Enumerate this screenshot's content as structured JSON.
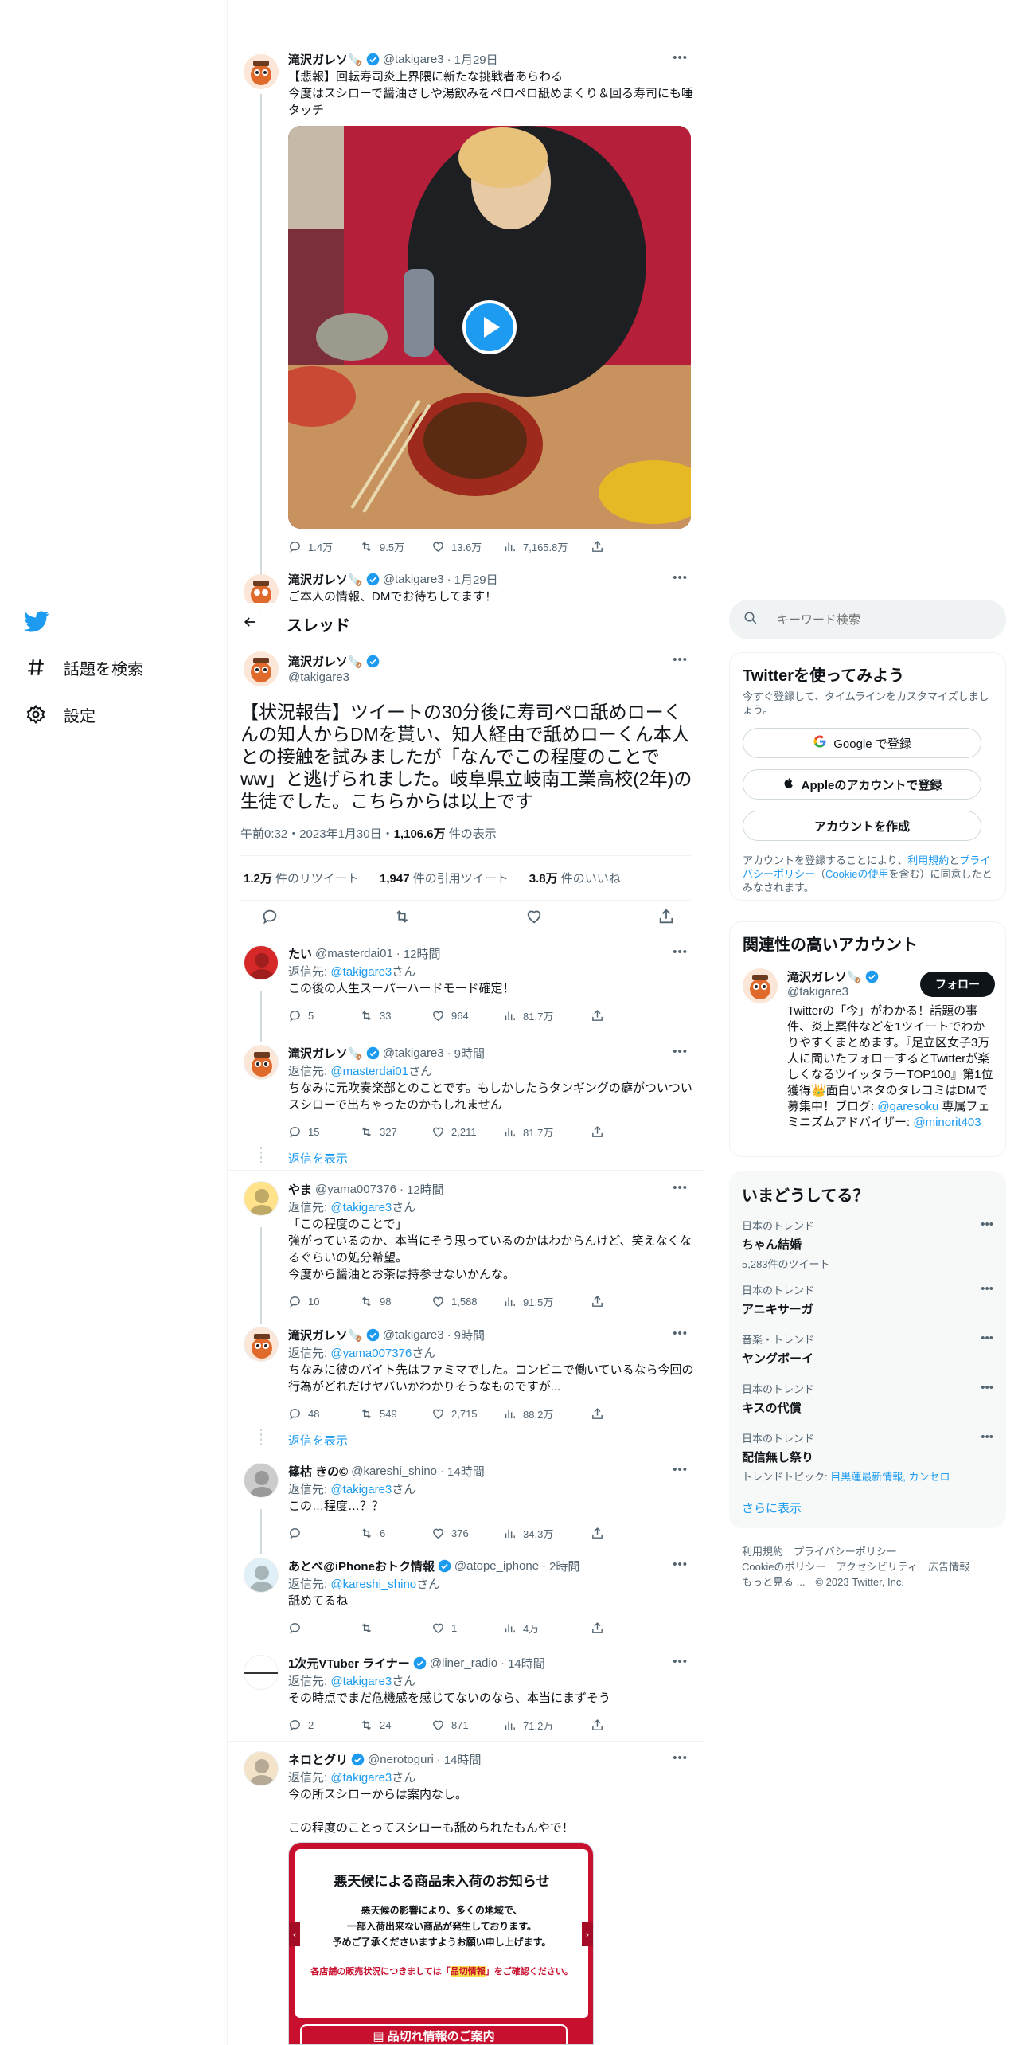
{
  "nav": {
    "explore_label": "話題を検索",
    "settings_label": "設定"
  },
  "header": {
    "title": "スレッド"
  },
  "search": {
    "placeholder": "キーワード検索"
  },
  "prev_tweet": {
    "name": "滝沢ガレソ🪚",
    "handle": "@takigare3",
    "date": "1月29日",
    "text": "【悲報】回転寿司炎上界隈に新たな挑戦者あらわる\n今度はスシローで醤油さしや湯飲みをペロペロ舐めまくり＆回る寿司にも唾タッチ",
    "replies": "1.4万",
    "retweets": "9.5万",
    "likes": "13.6万",
    "views": "7,165.8万"
  },
  "prev_tweet2": {
    "name": "滝沢ガレソ🪚",
    "handle": "@takigare3",
    "date": "1月29日",
    "text": "ご本人の情報、DMでお待ちしてます！"
  },
  "main_tweet": {
    "name": "滝沢ガレソ🪚",
    "handle": "@takigare3",
    "text": "【状況報告】ツイートの30分後に寿司ペロ舐めローくんの知人からDMを貰い、知人経由で舐めローくん本人との接触を試みましたが「なんでこの程度のことでww」と逃げられました。岐阜県立岐南工業高校(2年)の生徒でした。こちらからは以上です",
    "meta_time": "午前0:32・2023年1月30日・",
    "meta_views": "1,106.6万",
    "meta_views_suffix": " 件の表示",
    "rt_count": "1.2万",
    "rt_label": " 件のリツイート",
    "qt_count": "1,947",
    "qt_label": " 件の引用ツイート",
    "like_count": "3.8万",
    "like_label": " 件のいいね"
  },
  "replies": [
    {
      "name": "たい",
      "handle": "@masterdai01",
      "time": "12時間",
      "reply_to": "@takigare3",
      "text": "この後の人生スーパーハードモード確定！",
      "replies": "5",
      "retweets": "33",
      "likes": "964",
      "views": "81.7万"
    },
    {
      "name": "滝沢ガレソ🪚",
      "handle": "@takigare3",
      "time": "9時間",
      "reply_to": "@masterdai01",
      "text": "ちなみに元吹奏楽部とのことです。もしかしたらタンギングの癖がついついスシローで出ちゃったのかもしれません",
      "replies": "15",
      "retweets": "327",
      "likes": "2,211",
      "views": "81.7万"
    },
    {
      "name": "やま",
      "handle": "@yama007376",
      "time": "12時間",
      "reply_to": "@takigare3",
      "text": "「この程度のことで」\n強がっているのか、本当にそう思っているのかはわからんけど、笑えなくなるぐらいの処分希望。\n今度から醤油とお茶は持参せないかんな。",
      "replies": "10",
      "retweets": "98",
      "likes": "1,588",
      "views": "91.5万"
    },
    {
      "name": "滝沢ガレソ🪚",
      "handle": "@takigare3",
      "time": "9時間",
      "reply_to": "@yama007376",
      "text": "ちなみに彼のバイト先はファミマでした。コンビニで働いているなら今回の行為がどれだけヤバいかわかりそうなものですが...",
      "replies": "48",
      "retweets": "549",
      "likes": "2,715",
      "views": "88.2万"
    },
    {
      "name": "篠枯 きの©",
      "handle": "@kareshi_shino",
      "time": "14時間",
      "reply_to": "@takigare3",
      "text": "この…程度…？？",
      "replies": "",
      "retweets": "6",
      "likes": "376",
      "views": "34.3万"
    },
    {
      "name": "あとべ@iPhoneおトク情報",
      "handle": "@atope_iphone",
      "time": "2時間",
      "reply_to": "@kareshi_shino",
      "text": "舐めてるね",
      "replies": "",
      "retweets": "",
      "likes": "1",
      "views": "4万"
    },
    {
      "name": "1次元VTuber ライナー",
      "handle": "@liner_radio",
      "time": "14時間",
      "reply_to": "@takigare3",
      "text": "その時点でまだ危機感を感じてないのなら、本当にまずそう",
      "replies": "2",
      "retweets": "24",
      "likes": "871",
      "views": "71.2万"
    },
    {
      "name": "ネロとグリ",
      "handle": "@nerotoguri",
      "time": "14時間",
      "reply_to": "@takigare3",
      "text": "今の所スシローからは案内なし。\n\nこの程度のことってスシローも舐められたもんやで！"
    }
  ],
  "show_replies": "返信を表示",
  "reply_prefix": "返信先: ",
  "reply_suffix": "さん",
  "notice": {
    "title": "悪天候による商品未入荷のお知らせ",
    "body1": "悪天候の影響により、多くの地域で、",
    "body2": "一部入荷出来ない商品が発生しております。",
    "body3": "予めご了承くださいますようお願い申し上げます。",
    "red_pre": "各店舗の販売状況につきましては「",
    "red_link": "品切情報",
    "red_post": "」をご確認ください。",
    "button": "品切れ情報のご案内"
  },
  "signup": {
    "title": "Twitterを使ってみよう",
    "subtitle": "今すぐ登録して、タイムラインをカスタマイズしましょう。",
    "google": "Google で登録",
    "apple": "Appleのアカウントで登録",
    "create": "アカウントを作成",
    "legal_pre": "アカウントを登録することにより、",
    "legal_terms": "利用規約",
    "legal_and": "と",
    "legal_privacy": "プライバシーポリシー",
    "legal_cookie_pre": "（",
    "legal_cookie": "Cookieの使用",
    "legal_post": "を含む）に同意したとみなされます。"
  },
  "related": {
    "title": "関連性の高いアカウント",
    "name": "滝沢ガレソ🪚",
    "handle": "@takigare3",
    "follow": "フォロー",
    "bio": "Twitterの「今」がわかる！話題の事件、炎上案件などを1ツイートでわかりやすくまとめます。『足立区女子3万人に聞いたフォローするとTwitterが楽しくなるツイッタラーTOP100』第1位獲得👑面白いネタのタレコミはDMで募集中！ブログ: ",
    "bio_link1": "@garesoku",
    "bio_mid": " 専属フェミニズムアドバイザー: ",
    "bio_link2": "@minorit403"
  },
  "trends": {
    "title": "いまどうしてる？",
    "items": [
      {
        "category": "日本のトレンド",
        "name": "ちゃん結婚",
        "count": "5,283件のツイート"
      },
      {
        "category": "日本のトレンド",
        "name": "アニキサーガ",
        "count": ""
      },
      {
        "category": "音楽・トレンド",
        "name": "ヤングボーイ",
        "count": ""
      },
      {
        "category": "日本のトレンド",
        "name": "キスの代償",
        "count": ""
      },
      {
        "category": "日本のトレンド",
        "name": "配信無し祭り",
        "count": ""
      }
    ],
    "topic_pre": "トレンドトピック: ",
    "topic_links": "目黒蓮最新情報, カンセロ",
    "more": "さらに表示"
  },
  "footer": {
    "terms": "利用規約",
    "privacy": "プライバシーポリシー",
    "cookie": "Cookieのポリシー",
    "accessibility": "アクセシビリティ",
    "ads": "広告情報",
    "more": "もっと見る ...",
    "copyright": "© 2023 Twitter, Inc."
  },
  "colors": {
    "accent": "#1d9bf0",
    "text": "#0f1419",
    "muted": "#536471",
    "border": "#eff3f4"
  }
}
